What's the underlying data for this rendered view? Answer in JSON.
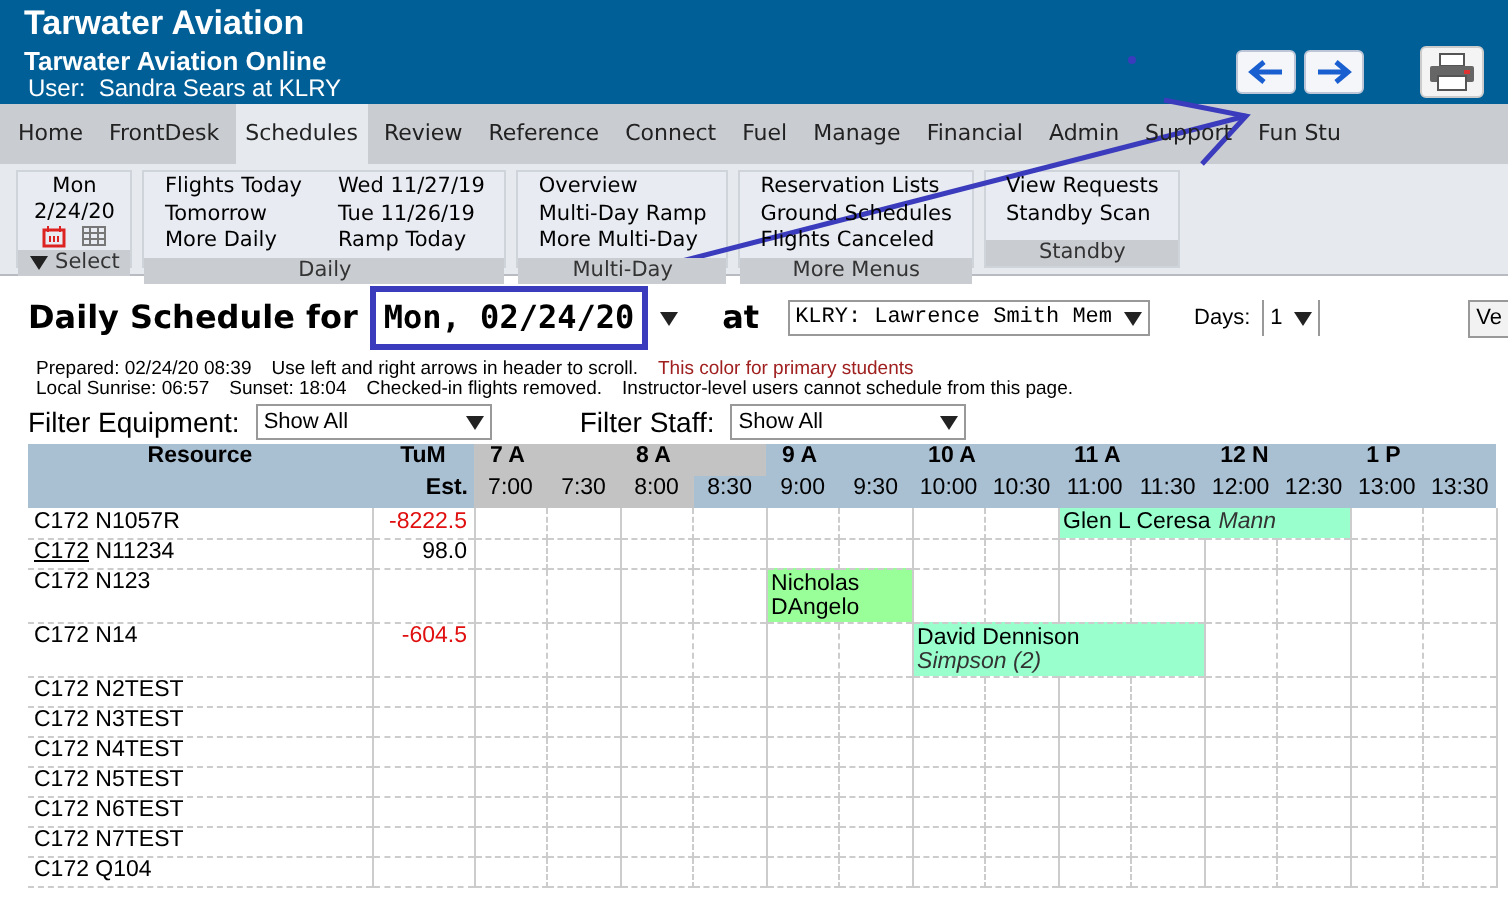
{
  "header": {
    "org": "Tarwater Aviation",
    "app": "Tarwater Aviation Online",
    "user": "User:  Sandra Sears at KLRY"
  },
  "nav_tabs": [
    {
      "label": "Home",
      "selected": false
    },
    {
      "label": "FrontDesk",
      "selected": false
    },
    {
      "label": "Schedules",
      "selected": true
    },
    {
      "label": "Review",
      "selected": false
    },
    {
      "label": "Reference",
      "selected": false
    },
    {
      "label": "Connect",
      "selected": false
    },
    {
      "label": "Fuel",
      "selected": false
    },
    {
      "label": "Manage",
      "selected": false
    },
    {
      "label": "Financial",
      "selected": false
    },
    {
      "label": "Admin",
      "selected": false
    },
    {
      "label": "Support",
      "selected": false
    },
    {
      "label": "Fun Stu",
      "selected": false
    }
  ],
  "submenu": {
    "date_group": {
      "day": "Mon",
      "date": "2/24/20",
      "footer": "Select"
    },
    "groups": [
      {
        "title": "Daily",
        "columns": [
          [
            "Flights Today",
            "Tomorrow",
            "More Daily"
          ],
          [
            "Wed 11/27/19",
            "Tue 11/26/19",
            "Ramp Today"
          ]
        ]
      },
      {
        "title": "Multi-Day",
        "columns": [
          [
            "Overview",
            "Multi-Day Ramp",
            "More Multi-Day"
          ]
        ]
      },
      {
        "title": "More Menus",
        "columns": [
          [
            "Reservation Lists",
            "Ground Schedules",
            "Flights Canceled"
          ]
        ]
      },
      {
        "title": "Standby",
        "columns": [
          [
            "View Requests",
            "Standby Scan"
          ]
        ]
      }
    ]
  },
  "schedule_header": {
    "title": "Daily Schedule for",
    "date": "Mon, 02/24/20",
    "date_highlighted": true,
    "at": "at",
    "location": "KLRY: Lawrence Smith Mem",
    "days_label": "Days:",
    "days": "1",
    "view_button": "Ve"
  },
  "info": {
    "prepared": "Prepared: 02/24/20 08:39",
    "scroll_hint": "Use left and right arrows in header to scroll.",
    "legend": "This color for primary students",
    "sunrise": "Local Sunrise: 06:57",
    "sunset": "Sunset: 18:04",
    "checked_in": "Checked-in flights removed.",
    "instructor_note": "Instructor-level users cannot schedule from this page."
  },
  "filters": [
    {
      "label": "Filter Equipment:",
      "value": "Show All"
    },
    {
      "label": "Filter Staff:",
      "value": "Show All"
    }
  ],
  "table": {
    "resource_heading": "Resource",
    "est_heading_1": "TuM",
    "est_heading_2": "Est.",
    "hours": [
      {
        "label": "7 A",
        "dim": true
      },
      {
        "label": "8 A",
        "dim": true
      },
      {
        "label": "9 A",
        "dim": false
      },
      {
        "label": "10 A",
        "dim": false
      },
      {
        "label": "11 A",
        "dim": false
      },
      {
        "label": "12 N",
        "dim": false
      },
      {
        "label": "1 P",
        "dim": false
      }
    ],
    "slots": [
      {
        "label": "7:00",
        "dim": true
      },
      {
        "label": "7:30",
        "dim": true
      },
      {
        "label": "8:00",
        "dim": true
      },
      {
        "label": "8:30",
        "dim": false
      },
      {
        "label": "9:00",
        "dim": false
      },
      {
        "label": "9:30",
        "dim": false
      },
      {
        "label": "10:00",
        "dim": false
      },
      {
        "label": "10:30",
        "dim": false
      },
      {
        "label": "11:00",
        "dim": false
      },
      {
        "label": "11:30",
        "dim": false
      },
      {
        "label": "12:00",
        "dim": false
      },
      {
        "label": "12:30",
        "dim": false
      },
      {
        "label": "13:00",
        "dim": false
      },
      {
        "label": "13:30",
        "dim": false
      }
    ],
    "rows": [
      {
        "model": "C172",
        "tail": "N1057R",
        "model_link": false,
        "est": "-8222.5",
        "est_negative": true,
        "tall": false,
        "timeline": [
          {
            "kind": "free"
          },
          {
            "kind": "free"
          },
          {
            "kind": "free"
          },
          {
            "kind": "free"
          },
          {
            "kind": "free"
          },
          {
            "kind": "free"
          },
          {
            "kind": "free"
          },
          {
            "kind": "free"
          },
          {
            "kind": "booking",
            "name": "Glen L Ceresa",
            "instructor": "Mann",
            "color": "#99ffcc"
          },
          {
            "kind": "continued"
          },
          {
            "kind": "continued"
          },
          {
            "kind": "continued"
          },
          {
            "kind": "free"
          },
          {
            "kind": "free"
          }
        ]
      },
      {
        "model": "C172",
        "tail": "N11234",
        "model_link": true,
        "est": "98.0",
        "est_negative": false,
        "tall": false
      },
      {
        "model": "C172",
        "tail": "N123",
        "model_link": false,
        "tall": true,
        "timeline": [
          {
            "kind": "free"
          },
          {
            "kind": "free"
          },
          {
            "kind": "free"
          },
          {
            "kind": "free"
          },
          {
            "kind": "booking",
            "name": "Nicholas DAngelo",
            "color": "#99ff99"
          },
          {
            "kind": "continued"
          },
          {
            "kind": "free"
          },
          {
            "kind": "free"
          },
          {
            "kind": "free"
          },
          {
            "kind": "free"
          },
          {
            "kind": "free"
          },
          {
            "kind": "free"
          },
          {
            "kind": "free"
          },
          {
            "kind": "free"
          }
        ]
      },
      {
        "model": "C172",
        "tail": "N14",
        "model_link": false,
        "est": "-604.5",
        "est_negative": true,
        "tall": true,
        "timeline": [
          {
            "kind": "free"
          },
          {
            "kind": "free"
          },
          {
            "kind": "free"
          },
          {
            "kind": "free"
          },
          {
            "kind": "free"
          },
          {
            "kind": "free"
          },
          {
            "kind": "booking",
            "name": "David Dennison",
            "instructor": "Simpson (2)",
            "color": "#99ffcc"
          },
          {
            "kind": "continued"
          },
          {
            "kind": "continued"
          },
          {
            "kind": "continued"
          },
          {
            "kind": "free"
          },
          {
            "kind": "free"
          },
          {
            "kind": "free"
          },
          {
            "kind": "free"
          }
        ]
      },
      {
        "model": "C172",
        "tail": "N2TEST",
        "model_link": false,
        "tall": false
      },
      {
        "model": "C172",
        "tail": "N3TEST",
        "model_link": false,
        "tall": false
      },
      {
        "model": "C172",
        "tail": "N4TEST",
        "model_link": false,
        "tall": false
      },
      {
        "model": "C172",
        "tail": "N5TEST",
        "model_link": false,
        "tall": false
      },
      {
        "model": "C172",
        "tail": "N6TEST",
        "model_link": false,
        "tall": false
      },
      {
        "model": "C172",
        "tail": "N7TEST",
        "model_link": false,
        "tall": false
      },
      {
        "model": "C172",
        "tail": "Q104",
        "model_link": false,
        "tall": false
      }
    ]
  }
}
